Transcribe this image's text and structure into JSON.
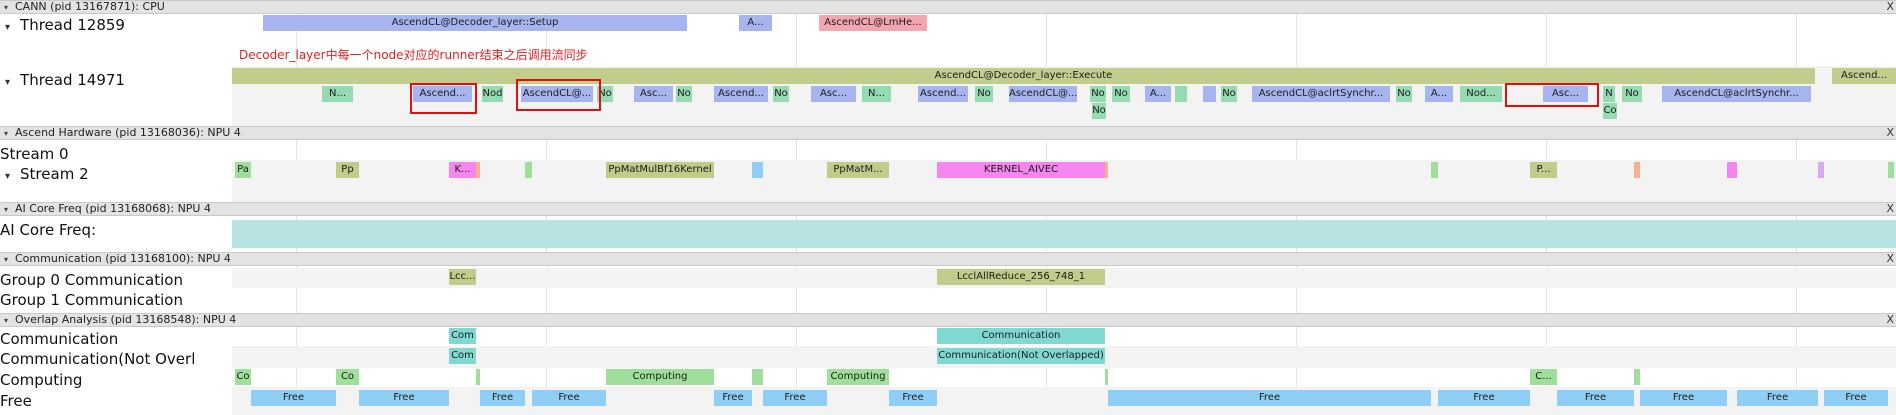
{
  "processes": [
    {
      "label": "CANN (pid 13167871): CPU"
    },
    {
      "label": "Ascend Hardware (pid 13168036): NPU 4"
    },
    {
      "label": "AI Core Freq (pid 13168068): NPU 4"
    },
    {
      "label": "Communication (pid 13168100): NPU 4"
    },
    {
      "label": "Overlap Analysis (pid 13168548): NPU 4"
    }
  ],
  "close_glyph": "X",
  "threads": {
    "thread_12859": "Thread 12859",
    "thread_14971": "Thread 14971",
    "stream_0": "Stream 0",
    "stream_2": "Stream 2",
    "ai_core_freq": "AI Core Freq:",
    "group0": "Group 0 Communication",
    "group1": "Group 1 Communication",
    "ov_comm": "Communication",
    "ov_comm_no": "Communication(Not Overlapped",
    "ov_computing": "Computing",
    "ov_free": "Free"
  },
  "annotation": "Decoder_layer中每一个node对应的runner结束之后调用流同步",
  "slices": {
    "t12859": [
      {
        "label": "AscendCL@Decoder_layer::Setup"
      },
      {
        "label": "A..."
      },
      {
        "label": "AscendCL@LmHe..."
      }
    ],
    "t14971_top": [
      {
        "label": "AscendCL@Decoder_layer::Execute"
      },
      {
        "label": "Ascend..."
      }
    ],
    "t14971_l2": [
      "N...",
      "Ascend...",
      "Nod",
      "AscendCL@...",
      "No",
      "Asc...",
      "No",
      "Ascend...",
      "No",
      "Asc...",
      "N...",
      "Ascend...",
      "No",
      "AscendCL@...",
      "No",
      "No",
      "A...",
      "",
      "",
      "No",
      "AscendCL@aclrtSynchr...",
      "No",
      "A...",
      "Nod...",
      "Asc...",
      "N",
      "No",
      "AscendCL@aclrtSynchr..."
    ],
    "t14971_l3": [
      "No",
      "Co"
    ],
    "stream2": [
      "Pa",
      "Pp",
      "K...",
      "",
      "",
      "PpMatMulBf16Kernel",
      "",
      "PpMatM...",
      "KERNEL_AIVEC",
      "",
      "",
      "P...",
      "",
      "",
      "",
      ""
    ],
    "group0": [
      "Lcc...",
      "LcclAllReduce_256_748_1"
    ],
    "ov_comm": [
      "Com",
      "Communication"
    ],
    "ov_comm_no": [
      "Com",
      "Communication(Not Overlapped)"
    ],
    "ov_computing": [
      "Co",
      "Co",
      "",
      "Computing",
      "",
      "Computing",
      "",
      "C...",
      ""
    ],
    "ov_free": [
      "Free",
      "Free",
      "Free",
      "Free",
      "Free",
      "Free",
      "Free",
      "Free",
      "Free",
      "Free",
      "Free",
      "Free",
      "Free"
    ]
  }
}
